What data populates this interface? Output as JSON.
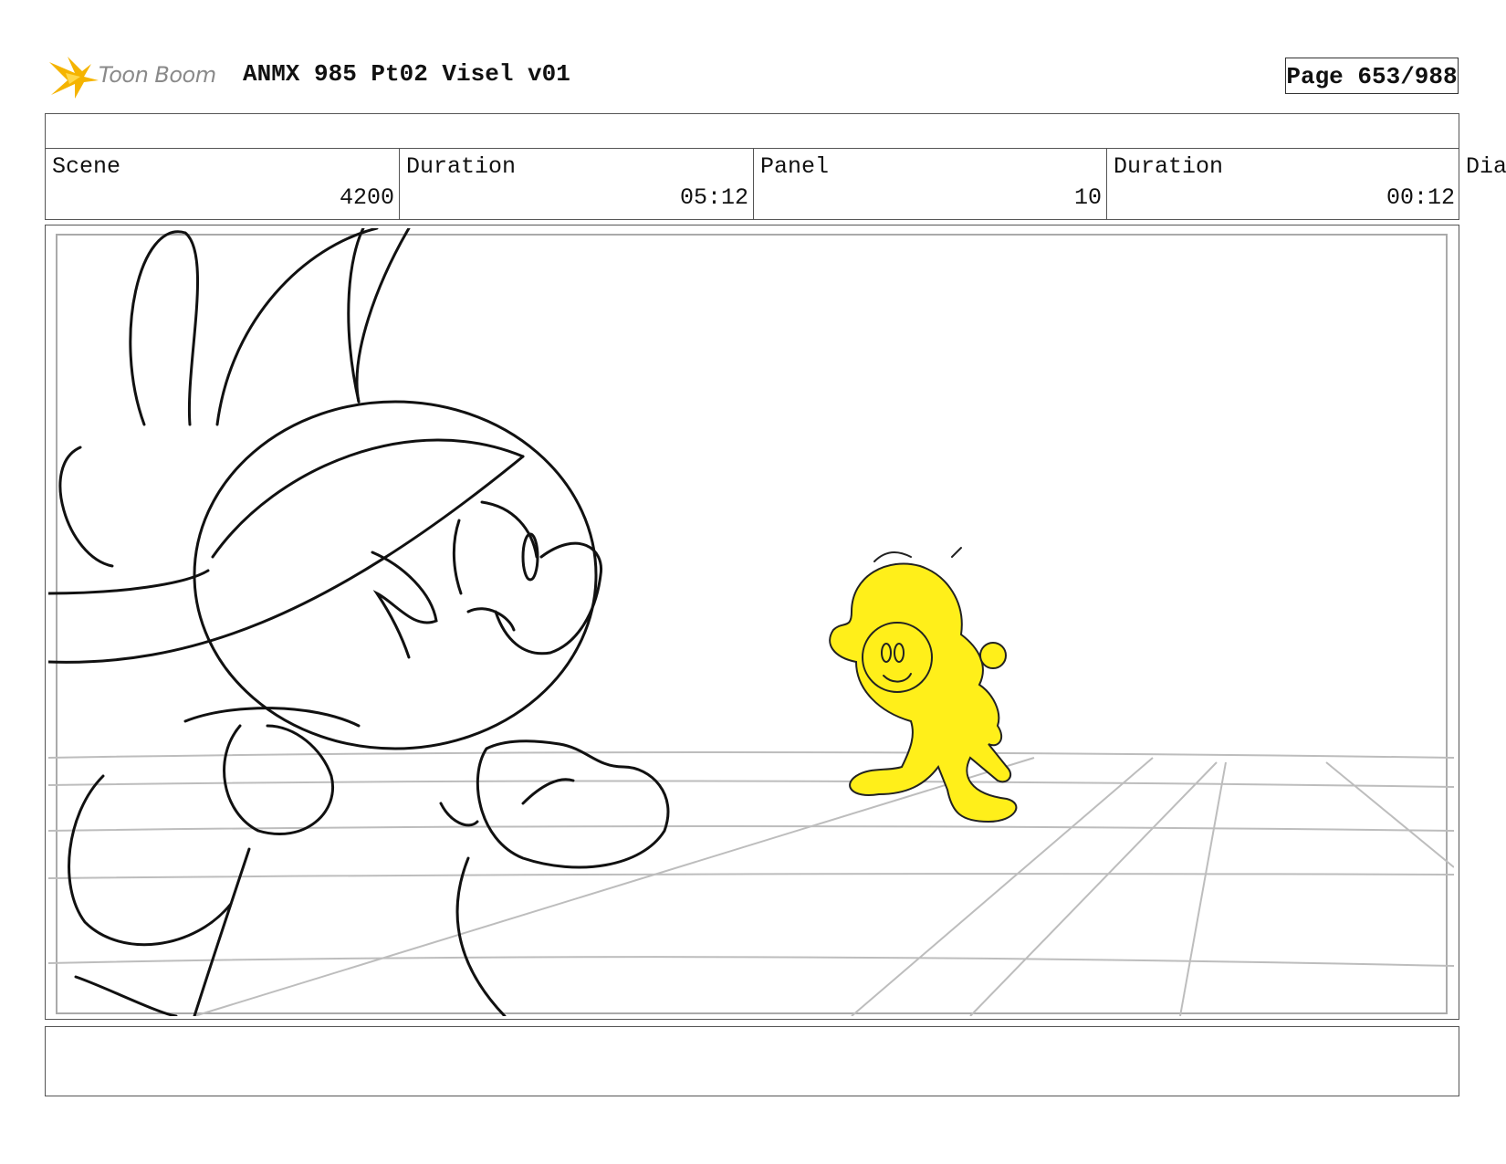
{
  "header": {
    "logo_text": "Toon Boom",
    "title": "ANMX 985 Pt02 Visel v01",
    "page_label": "Page 653/988"
  },
  "info": {
    "scene_label": "Scene",
    "scene_value": "4200",
    "scene_duration_label": "Duration",
    "scene_duration_value": "05:12",
    "panel_label": "Panel",
    "panel_value": "10",
    "panel_duration_label": "Duration",
    "panel_duration_value": "00:12",
    "dialogue_label": "Dia"
  },
  "colors": {
    "logo_accent": "#f5b400",
    "character_highlight": "#ffef1a",
    "sketch_line": "#111111",
    "floor_grid": "#bdbdbd"
  }
}
